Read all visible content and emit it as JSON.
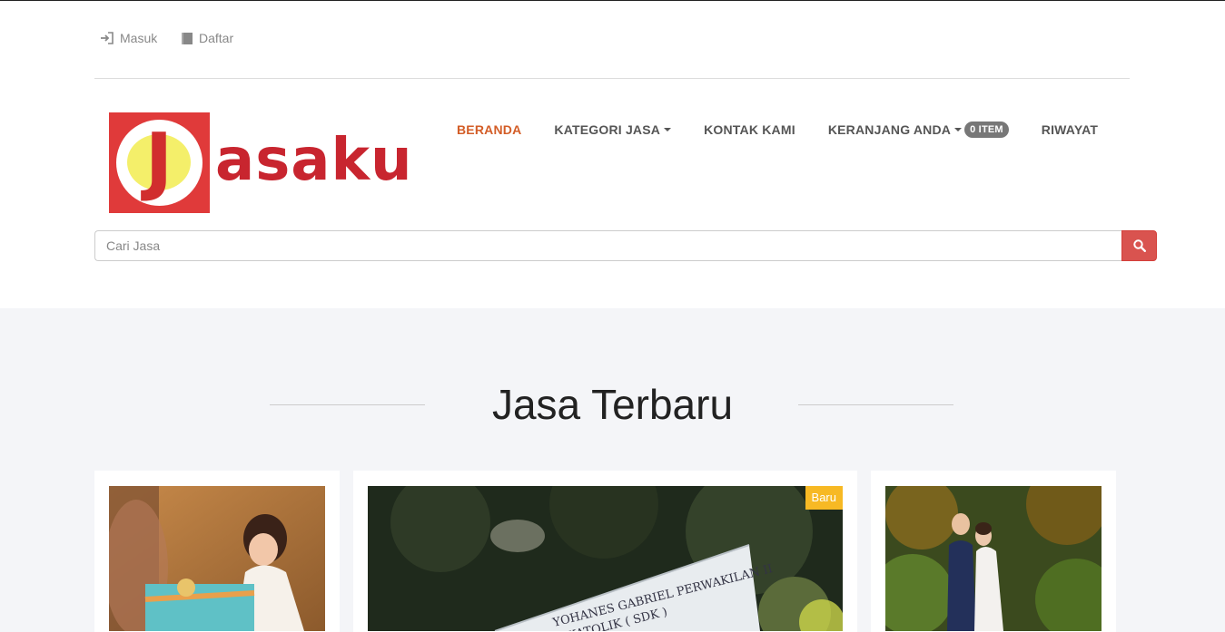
{
  "topbar": {
    "login_label": "Masuk",
    "register_label": "Daftar"
  },
  "logo": {
    "letter": "J",
    "text": "asaku"
  },
  "nav": {
    "home": "BERANDA",
    "categories": "KATEGORI JASA",
    "contact": "KONTAK KAMI",
    "cart": "KERANJANG ANDA",
    "cart_badge": "0 ITEM",
    "history": "RIWAYAT"
  },
  "search": {
    "placeholder": "Cari Jasa"
  },
  "section": {
    "title": "Jasa Terbaru"
  },
  "cards": [
    {
      "image": "child-with-gift-photo"
    },
    {
      "image": "school-sign-photo",
      "badge": "Baru",
      "sign_line1": "YOHANES GABRIEL PERWAKILAN II",
      "sign_line2": "AP KATOLIK ( SDK )"
    },
    {
      "image": "wedding-couple-photo"
    }
  ],
  "colors": {
    "accent": "#d35d27",
    "search_button": "#d9534f",
    "badge_new": "#f7b924",
    "logo_red": "#c8252f"
  }
}
